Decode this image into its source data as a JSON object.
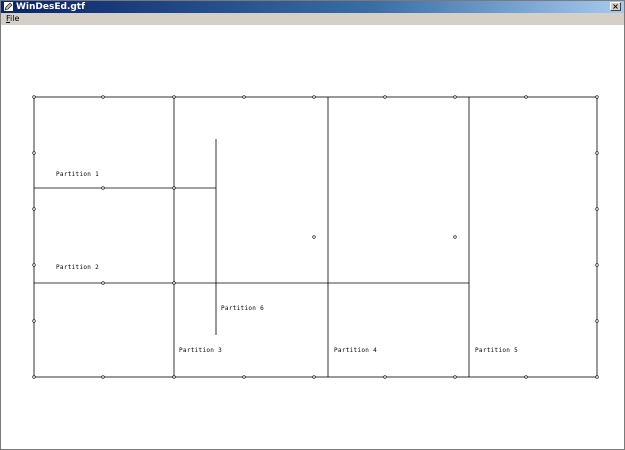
{
  "window": {
    "title": "WinDesEd.gtf",
    "close_glyph": "×"
  },
  "menu": {
    "file_mnemonic": "F",
    "file_rest": "ile"
  },
  "partitions": [
    {
      "label": "Partition 1"
    },
    {
      "label": "Partition 2"
    },
    {
      "label": "Partition 3"
    },
    {
      "label": "Partition 4"
    },
    {
      "label": "Partition 5"
    },
    {
      "label": "Partition 6"
    }
  ]
}
